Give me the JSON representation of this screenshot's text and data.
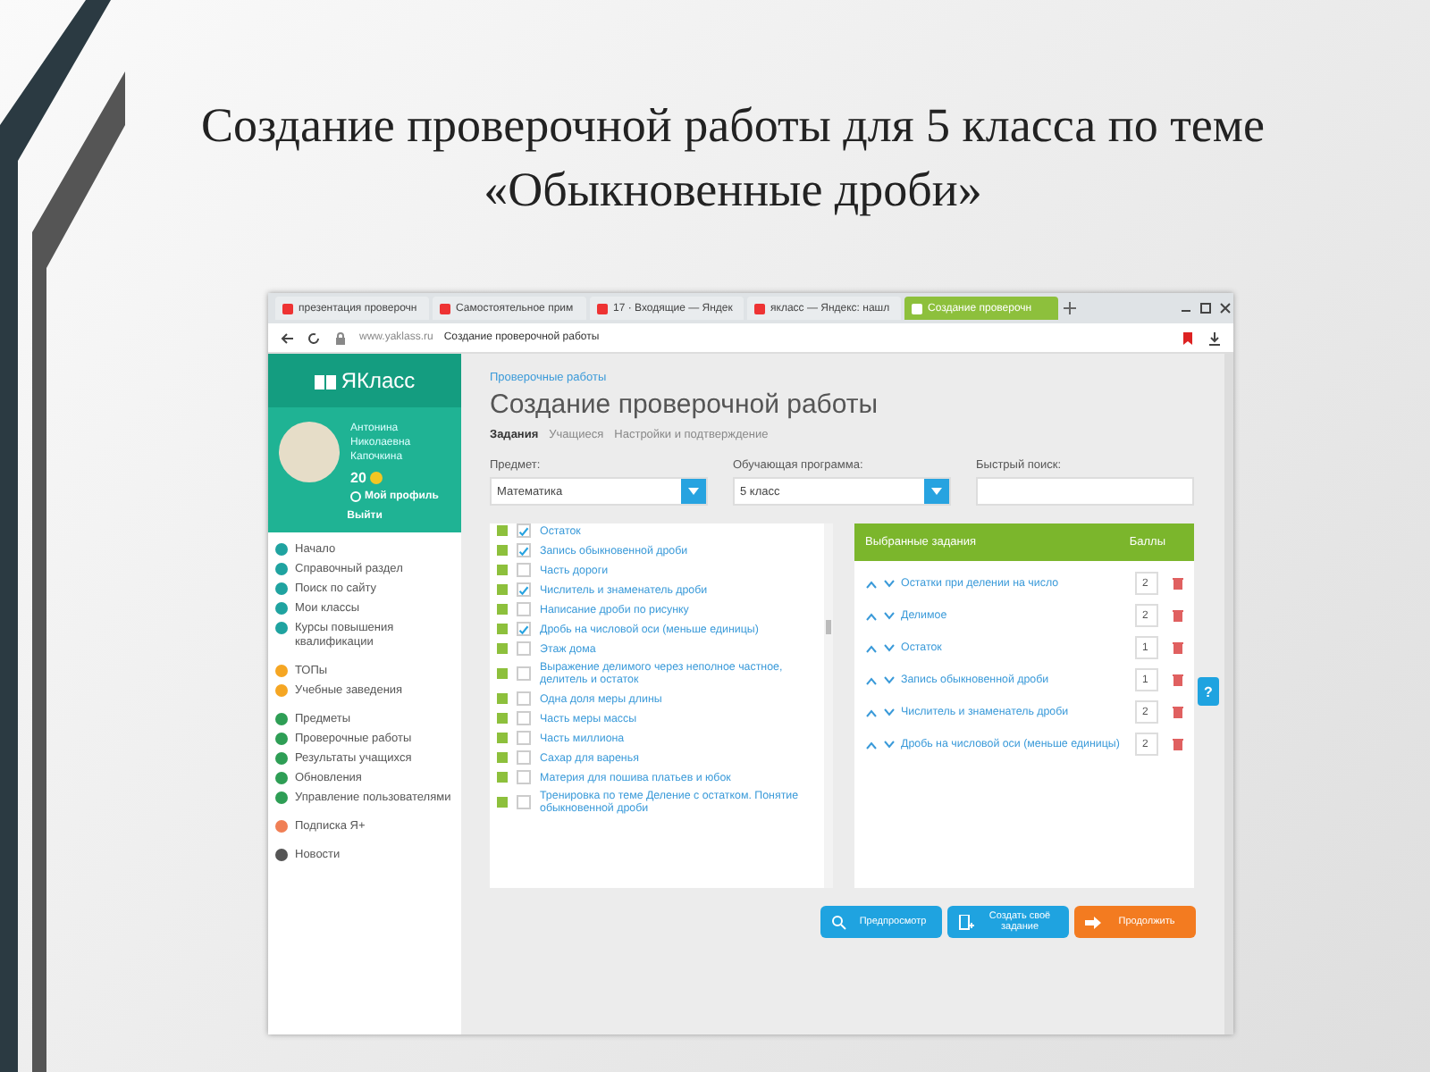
{
  "slide": {
    "title": "Создание проверочной работы для 5 класса по теме «Обыкновенные дроби»"
  },
  "browser": {
    "tabs": [
      {
        "label": "презентация проверочн",
        "selected": false
      },
      {
        "label": "Самостоятельное прим",
        "selected": false
      },
      {
        "label": "17 · Входящие — Яндек",
        "selected": false
      },
      {
        "label": "якласс — Яндекс: нашл",
        "selected": false
      },
      {
        "label": "Создание проверочн",
        "selected": true
      }
    ],
    "address": {
      "domain": "www.yaklass.ru",
      "page_title": "Создание проверочной работы"
    }
  },
  "sidebar": {
    "logo": "ЯКласс",
    "user": {
      "name": "Антонина Николаевна Капочкина",
      "points": "20",
      "profile_link": "Мой профиль",
      "logout": "Выйти"
    },
    "nav_groups": [
      {
        "items": [
          "Начало",
          "Справочный раздел",
          "Поиск по сайту",
          "Мои классы",
          "Курсы повышения квалификации"
        ]
      },
      {
        "items": [
          "ТОПы",
          "Учебные заведения"
        ]
      },
      {
        "items": [
          "Предметы",
          "Проверочные работы",
          "Результаты учащихся",
          "Обновления",
          "Управление пользователями"
        ]
      },
      {
        "items": [
          "Подписка Я+"
        ]
      },
      {
        "items": [
          "Новости"
        ]
      }
    ]
  },
  "main": {
    "breadcrumb": "Проверочные работы",
    "heading": "Создание проверочной работы",
    "steps": [
      {
        "label": "Задания",
        "selected": true
      },
      {
        "label": "Учащиеся",
        "selected": false
      },
      {
        "label": "Настройки и подтверждение",
        "selected": false
      }
    ],
    "filters": [
      {
        "kind": "select",
        "label": "Предмет:",
        "value": "Математика"
      },
      {
        "kind": "select",
        "label": "Обучающая программа:",
        "value": "5 класс"
      },
      {
        "kind": "search",
        "label": "Быстрый поиск:"
      }
    ],
    "tasks": [
      {
        "label": "Остаток",
        "checked": true
      },
      {
        "label": "Запись обыкновенной дроби",
        "checked": true
      },
      {
        "label": "Часть дороги",
        "checked": false
      },
      {
        "label": "Числитель и знаменатель дроби",
        "checked": true
      },
      {
        "label": "Написание дроби по рисунку",
        "checked": false
      },
      {
        "label": "Дробь на числовой оси (меньше единицы)",
        "checked": true
      },
      {
        "label": "Этаж дома",
        "checked": false
      },
      {
        "label": "Выражение делимого через неполное частное, делитель и остаток",
        "checked": false
      },
      {
        "label": "Одна доля меры длины",
        "checked": false
      },
      {
        "label": "Часть меры массы",
        "checked": false
      },
      {
        "label": "Часть миллиона",
        "checked": false
      },
      {
        "label": "Сахар для варенья",
        "checked": false
      },
      {
        "label": "Материя для пошива платьев и юбок",
        "checked": false
      },
      {
        "label": "Тренировка по теме Деление с остатком. Понятие обыкновенной дроби",
        "checked": false
      }
    ],
    "selected_panel": {
      "title": "Выбранные задания",
      "points_header": "Баллы",
      "rows": [
        {
          "label": "Остатки при делении на число",
          "points": "2"
        },
        {
          "label": "Делимое",
          "points": "2"
        },
        {
          "label": "Остаток",
          "points": "1"
        },
        {
          "label": "Запись обыкновенной дроби",
          "points": "1"
        },
        {
          "label": "Числитель и знаменатель дроби",
          "points": "2"
        },
        {
          "label": "Дробь на числовой оси (меньше единицы)",
          "points": "2"
        }
      ]
    },
    "buttons": [
      {
        "kind": "preview",
        "label": "Предпросмотр"
      },
      {
        "kind": "create",
        "label": "Создать своё задание"
      },
      {
        "kind": "continue",
        "label": "Продолжить"
      }
    ],
    "help": "?"
  }
}
